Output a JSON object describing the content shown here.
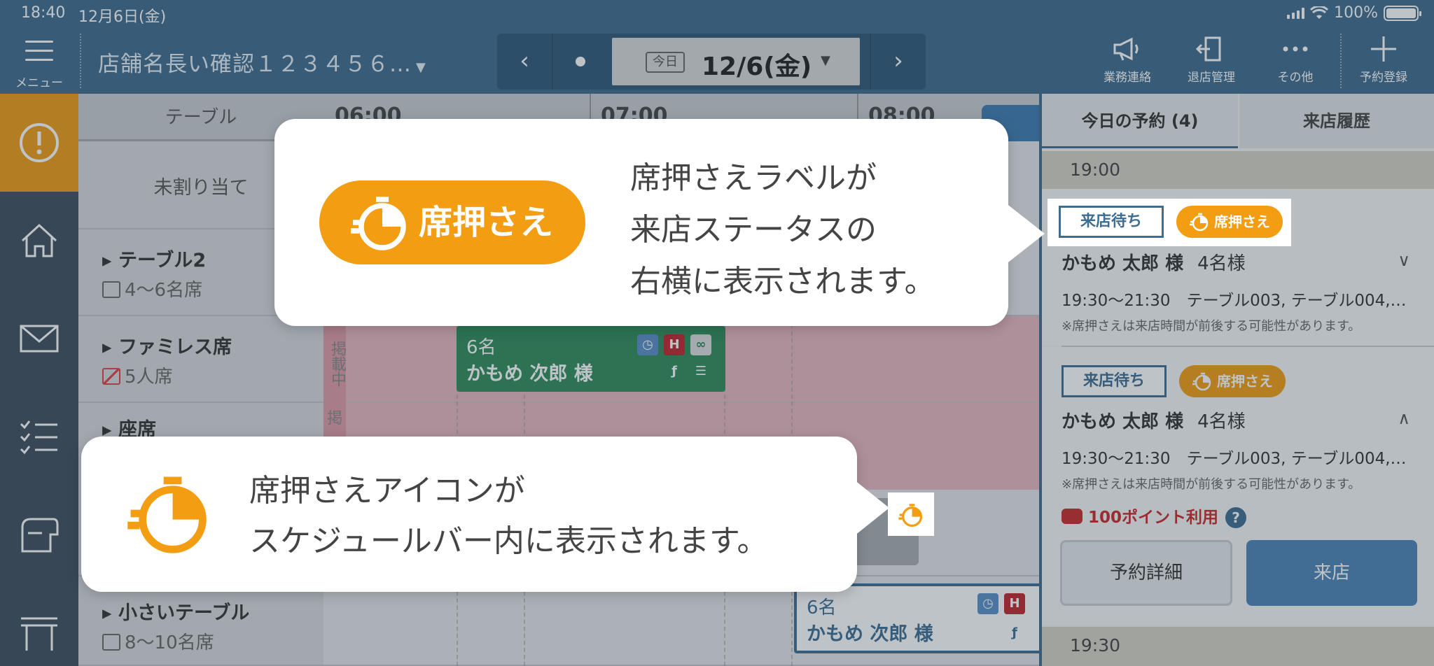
{
  "status": {
    "time": "18:40",
    "date": "12月6日(金)",
    "battery": "100%"
  },
  "header": {
    "menu_label": "メニュー",
    "shop_name": "店舗名長い確認１２３４５６…",
    "today_label": "今日",
    "date": "12/6(金)",
    "icons": [
      {
        "name": "megaphone-icon",
        "label": "業務連絡"
      },
      {
        "name": "exit-door-icon",
        "label": "退店管理"
      },
      {
        "name": "more-icon",
        "label": "その他"
      },
      {
        "name": "plus-icon",
        "label": "予約登録"
      }
    ]
  },
  "schedule": {
    "table_header": "テーブル",
    "times": [
      "06:00",
      "07:00",
      "08:00"
    ],
    "rows": [
      {
        "name": "未割り当て",
        "sub": ""
      },
      {
        "name": "テーブル2",
        "sub": "4〜6名席"
      },
      {
        "name": "ファミレス席",
        "sub": "5人席"
      },
      {
        "name": "座席",
        "sub": ""
      },
      {
        "name": "小さいテーブル",
        "sub": "8〜10名席"
      }
    ],
    "keisai": "掲載中",
    "keisai_short": "掲",
    "bars": [
      {
        "count": "6名",
        "guest": "かもめ 次郎 様"
      },
      {
        "count": "6名",
        "guest": "かもめ 次郎 様"
      }
    ]
  },
  "panel": {
    "tab_today": "今日の予約 (4)",
    "tab_history": "来店履歴",
    "time_1900": "19:00",
    "time_1930": "19:30",
    "status_wait": "来店待ち",
    "seat_hold": "席押さえ",
    "reservations": [
      {
        "guest": "かもめ 太郎 様",
        "count": "4名様",
        "time": "19:30〜21:30　テーブル003, テーブル004,…",
        "note": "※席押さえは来店時間が前後する可能性があります。"
      },
      {
        "guest": "かもめ 太郎 様",
        "count": "4名様",
        "time": "19:30〜21:30　テーブル003, テーブル004,…",
        "note": "※席押さえは来店時間が前後する可能性があります。",
        "points": "100ポイント利用",
        "help": "?",
        "detail_button": "予約詳細",
        "visit_button": "来店"
      }
    ]
  },
  "callouts": {
    "label_pill": "席押さえ",
    "label_text_1": "席押さえラベルが",
    "label_text_2": "来店ステータスの",
    "label_text_3": "右横に表示されます。",
    "icon_text_1": "席押さえアイコンが",
    "icon_text_2": "スケジュールバー内に表示されます。"
  },
  "colors": {
    "header": "#3f6c8e",
    "accent": "#f29d12",
    "green": "#2f8b5a",
    "alert": "#f09b16"
  }
}
